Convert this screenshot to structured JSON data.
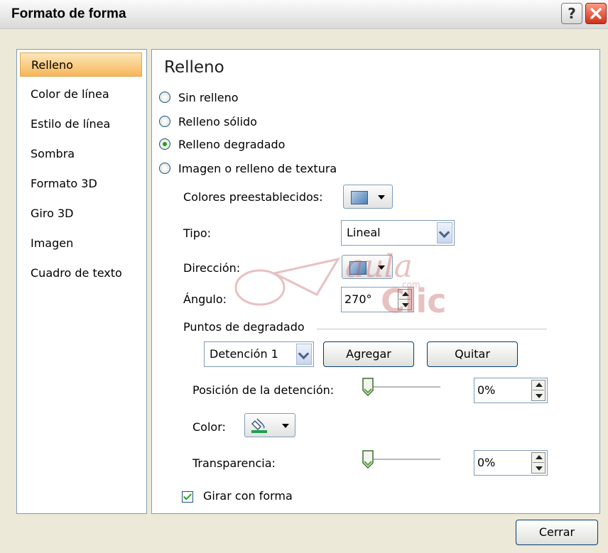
{
  "window": {
    "title": "Formato de forma",
    "help": "?"
  },
  "sidebar": {
    "items": [
      {
        "label": "Relleno",
        "active": true
      },
      {
        "label": "Color de línea"
      },
      {
        "label": "Estilo de línea"
      },
      {
        "label": "Sombra"
      },
      {
        "label": "Formato 3D"
      },
      {
        "label": "Giro 3D"
      },
      {
        "label": "Imagen"
      },
      {
        "label": "Cuadro de texto"
      }
    ]
  },
  "main": {
    "heading": "Relleno",
    "fill_options": [
      {
        "label": "Sin relleno",
        "checked": false
      },
      {
        "label": "Relleno sólido",
        "checked": false
      },
      {
        "label": "Relleno degradado",
        "checked": true
      },
      {
        "label": "Imagen o relleno de textura",
        "checked": false
      }
    ],
    "preset_colors_label": "Colores preestablecidos:",
    "type_label": "Tipo:",
    "type_value": "Lineal",
    "direction_label": "Dirección:",
    "angle_label": "Ángulo:",
    "angle_value": "270°",
    "gradient_stops_label": "Puntos de degradado",
    "stop_value": "Detención 1",
    "add_label": "Agregar",
    "remove_label": "Quitar",
    "stop_position_label": "Posición de la detención:",
    "stop_position_value": "0%",
    "stop_position_level": 0,
    "color_label": "Color:",
    "transparency_label": "Transparencia:",
    "transparency_value": "0%",
    "transparency_level": 0,
    "rotate_label": "Girar con forma",
    "rotate_checked": true
  },
  "footer": {
    "close_label": "Cerrar"
  },
  "watermark": {
    "text": "aula",
    "sub": "com",
    "text2": "Clic"
  },
  "colors": {
    "accent": "#f6b65a",
    "border": "#7f9db9",
    "check": "#20a020"
  }
}
